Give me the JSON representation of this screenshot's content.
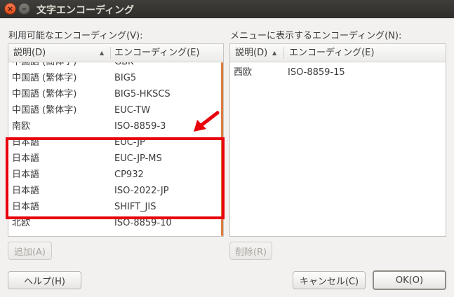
{
  "window": {
    "title": "文字エンコーディング"
  },
  "available": {
    "label": "利用可能なエンコーディング(V):",
    "col_description": "説明(D)",
    "col_encoding": "エンコーディング(E)",
    "rows": [
      {
        "description": "中国語 (簡体字)",
        "encoding": "GBK"
      },
      {
        "description": "中国語 (繁体字)",
        "encoding": "BIG5"
      },
      {
        "description": "中国語 (繁体字)",
        "encoding": "BIG5-HKSCS"
      },
      {
        "description": "中国語 (繁体字)",
        "encoding": "EUC-TW"
      },
      {
        "description": "南欧",
        "encoding": "ISO-8859-3"
      },
      {
        "description": "日本語",
        "encoding": "EUC-JP"
      },
      {
        "description": "日本語",
        "encoding": "EUC-JP-MS"
      },
      {
        "description": "日本語",
        "encoding": "CP932"
      },
      {
        "description": "日本語",
        "encoding": "ISO-2022-JP"
      },
      {
        "description": "日本語",
        "encoding": "SHIFT_JIS"
      },
      {
        "description": "北欧",
        "encoding": "ISO-8859-10"
      }
    ],
    "add_button": "追加(A)"
  },
  "menu": {
    "label": "メニューに表示するエンコーディング(N):",
    "col_description": "説明(D)",
    "col_encoding": "エンコーディング(E)",
    "rows": [
      {
        "description": "西欧",
        "encoding": "ISO-8859-15"
      }
    ],
    "remove_button": "削除(R)"
  },
  "footer": {
    "help_button": "ヘルプ(H)",
    "cancel_button": "キャンセル(C)",
    "ok_button": "OK(O)"
  },
  "colors": {
    "highlight": "#e8000b",
    "scrollbar": "#e07a3c"
  }
}
